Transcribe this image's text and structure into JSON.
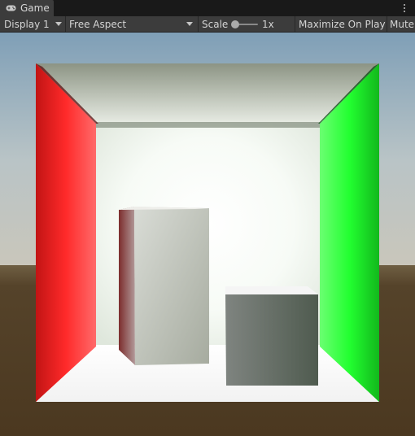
{
  "tab": {
    "title": "Game",
    "icon": "gamepad-icon"
  },
  "toolbar": {
    "display_label": "Display 1",
    "aspect_label": "Free Aspect",
    "scale_label": "Scale",
    "scale_value": "1x",
    "maximize_label": "Maximize On Play",
    "mute_label": "Mute"
  },
  "colors": {
    "red_wall": "#ff1f1f",
    "green_wall": "#1aff2a",
    "sky_top": "#7fa0b8",
    "ground": "#4c3a22"
  }
}
